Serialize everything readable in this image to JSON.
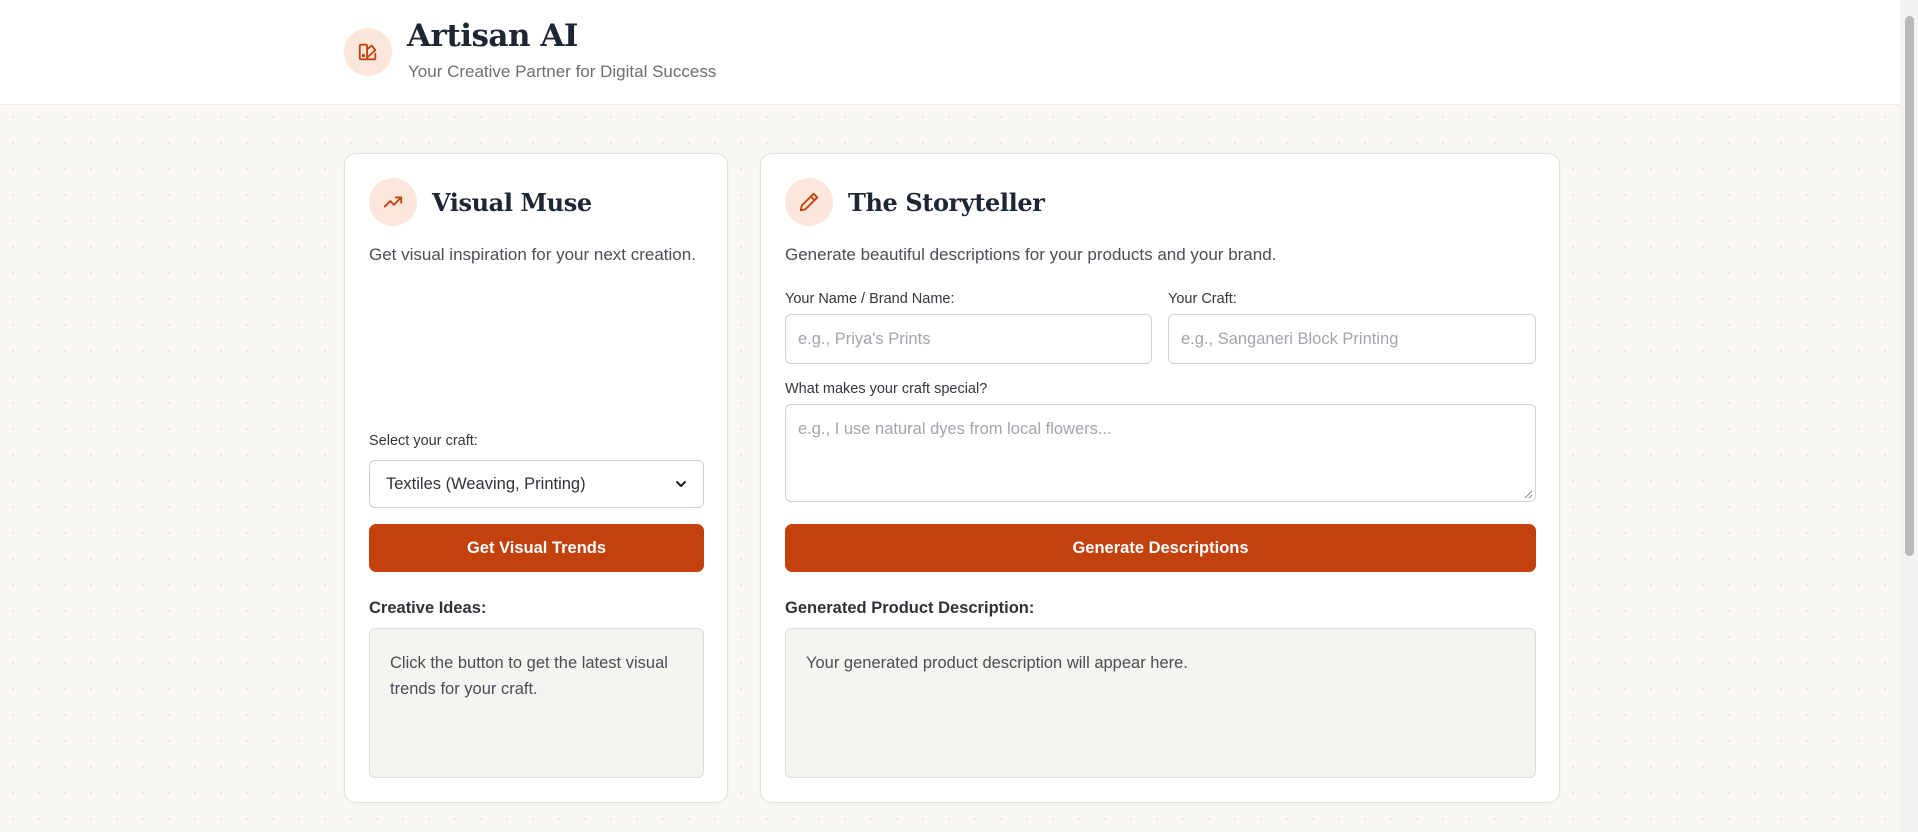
{
  "header": {
    "title": "Artisan AI",
    "subtitle": "Your Creative Partner for Digital Success",
    "logo_icon": "palette-icon"
  },
  "visual_muse": {
    "icon": "trending-up-icon",
    "title": "Visual Muse",
    "description": "Get visual inspiration for your next creation.",
    "select_label": "Select your craft:",
    "select_value": "Textiles (Weaving, Printing)",
    "button_label": "Get Visual Trends",
    "ideas_label": "Creative Ideas:",
    "ideas_placeholder": "Click the button to get the latest visual trends for your craft."
  },
  "storyteller": {
    "icon": "pencil-icon",
    "title": "The Storyteller",
    "description": "Generate beautiful descriptions for your products and your brand.",
    "name_label": "Your Name / Brand Name:",
    "name_placeholder": "e.g., Priya's Prints",
    "craft_label": "Your Craft:",
    "craft_placeholder": "e.g., Sanganeri Block Printing",
    "special_label": "What makes your craft special?",
    "special_placeholder": "e.g., I use natural dyes from local flowers...",
    "button_label": "Generate Descriptions",
    "output_label": "Generated Product Description:",
    "output_placeholder": "Your generated product description will appear here."
  },
  "colors": {
    "accent": "#c2410c",
    "icon_bg": "#fbe6dc",
    "page_bg": "#faf8f4"
  }
}
